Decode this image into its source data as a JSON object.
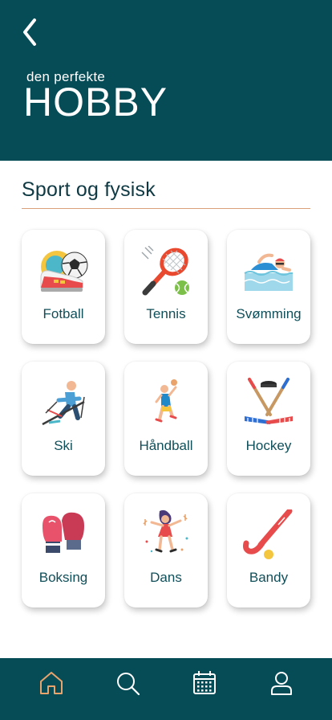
{
  "header": {
    "subtitle": "den perfekte",
    "title": "HOBBY",
    "back_icon": "chevron-left-icon",
    "background": "#054c57"
  },
  "section": {
    "title": "Sport og fysisk"
  },
  "hobbies": [
    {
      "label": "Fotball",
      "icon": "football-icon"
    },
    {
      "label": "Tennis",
      "icon": "tennis-icon"
    },
    {
      "label": "Svømming",
      "icon": "swimming-icon"
    },
    {
      "label": "Ski",
      "icon": "ski-icon"
    },
    {
      "label": "Håndball",
      "icon": "handball-icon"
    },
    {
      "label": "Hockey",
      "icon": "hockey-icon"
    },
    {
      "label": "Boksing",
      "icon": "boxing-icon"
    },
    {
      "label": "Dans",
      "icon": "dance-icon"
    },
    {
      "label": "Bandy",
      "icon": "bandy-icon"
    }
  ],
  "nav": [
    {
      "icon": "home-icon",
      "active": true
    },
    {
      "icon": "search-icon",
      "active": false
    },
    {
      "icon": "calendar-icon",
      "active": false
    },
    {
      "icon": "profile-icon",
      "active": false
    }
  ],
  "colors": {
    "accent_active": "#e9a36b",
    "nav_inactive": "#ffffff",
    "section_rule": "#d9a07a"
  }
}
